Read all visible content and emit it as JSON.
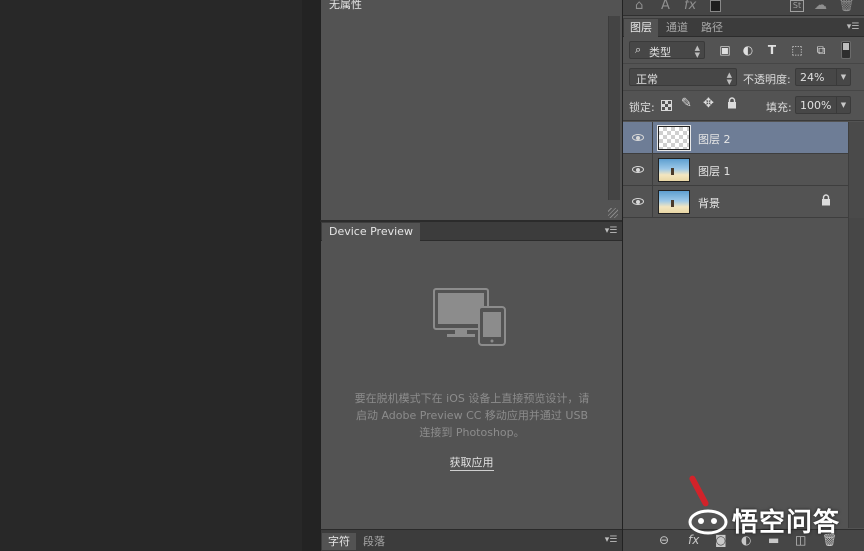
{
  "properties_panel": {
    "title": "无属性"
  },
  "device_preview": {
    "tab_label": "Device Preview",
    "message_lines": [
      "要在脱机模式下在 iOS 设备上直接预览设计，请",
      "启动 Adobe Preview CC 移动应用并通过 USB",
      "连接到 Photoshop。"
    ],
    "link_label": "获取应用"
  },
  "character_bar": {
    "tabs": [
      {
        "label": "字符",
        "active": true
      },
      {
        "label": "段落",
        "active": false
      }
    ]
  },
  "layers_panel": {
    "tabs": [
      {
        "label": "图层",
        "active": true
      },
      {
        "label": "通道",
        "active": false
      },
      {
        "label": "路径",
        "active": false
      }
    ],
    "filter": {
      "label": "类型",
      "icon": "search-icon"
    },
    "blend_mode": "正常",
    "opacity_label": "不透明度:",
    "opacity_value": "24%",
    "lock_label": "锁定:",
    "fill_label": "填充:",
    "fill_value": "100%",
    "layers": [
      {
        "name": "图层 2",
        "selected": true,
        "visible": true,
        "thumb": "transparent",
        "locked": false
      },
      {
        "name": "图层 1",
        "selected": false,
        "visible": true,
        "thumb": "photo",
        "locked": false
      },
      {
        "name": "背景",
        "selected": false,
        "visible": true,
        "thumb": "photo",
        "locked": true
      }
    ]
  },
  "top_toolbar": {
    "icons": [
      "stamp-icon",
      "text-icon",
      "fx-icon",
      "swatch-icon",
      "stock-icon",
      "cc-libraries-icon",
      "trash-icon"
    ],
    "text_icon_label": "A",
    "fx_label": "fx",
    "stock_label": "St"
  },
  "bottom_toolbar": {
    "fx_label": "fx"
  },
  "watermark": {
    "text": "悟空问答"
  },
  "colors": {
    "panel": "#535353",
    "selected_layer": "#6e7d96",
    "canvas": "#282828"
  }
}
